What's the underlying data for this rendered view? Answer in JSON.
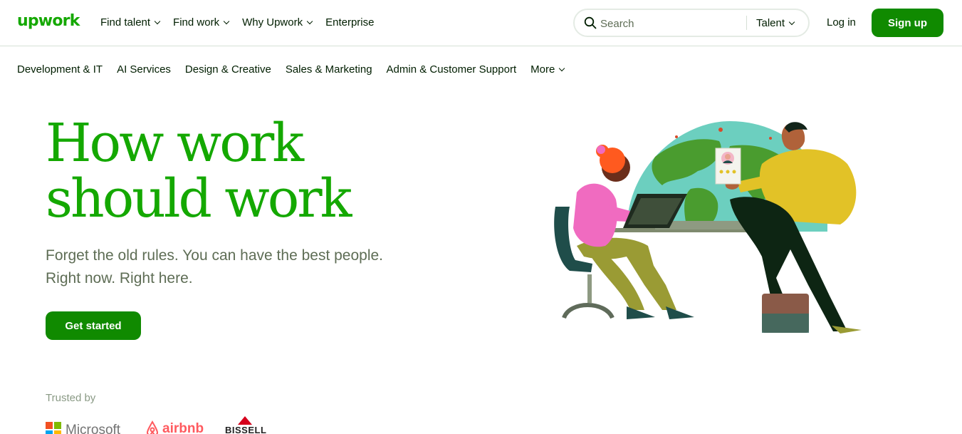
{
  "header": {
    "logo_text": "upwork",
    "nav": [
      {
        "label": "Find talent",
        "has_dropdown": true
      },
      {
        "label": "Find work",
        "has_dropdown": true
      },
      {
        "label": "Why Upwork",
        "has_dropdown": true
      },
      {
        "label": "Enterprise",
        "has_dropdown": false
      }
    ],
    "search": {
      "placeholder": "Search",
      "scope": "Talent"
    },
    "login_label": "Log in",
    "signup_label": "Sign up"
  },
  "categories": [
    {
      "label": "Development & IT"
    },
    {
      "label": "AI Services"
    },
    {
      "label": "Design & Creative"
    },
    {
      "label": "Sales & Marketing"
    },
    {
      "label": "Admin & Customer Support"
    },
    {
      "label": "More",
      "has_dropdown": true
    }
  ],
  "hero": {
    "title_line1": "How work",
    "title_line2": "should work",
    "subtitle_line1": "Forget the old rules. You can have the best people.",
    "subtitle_line2": "Right now. Right here.",
    "cta_label": "Get started"
  },
  "trusted": {
    "label": "Trusted by",
    "logos": {
      "microsoft": "Microsoft",
      "airbnb": "airbnb",
      "bissell": "BISSELL"
    }
  },
  "colors": {
    "brand_green": "#14a800",
    "button_green": "#108a00",
    "text_dark": "#001e00",
    "text_muted": "#5e6d55"
  },
  "icons": {
    "search": "search-icon",
    "dropdown": "chevron-down-icon"
  }
}
